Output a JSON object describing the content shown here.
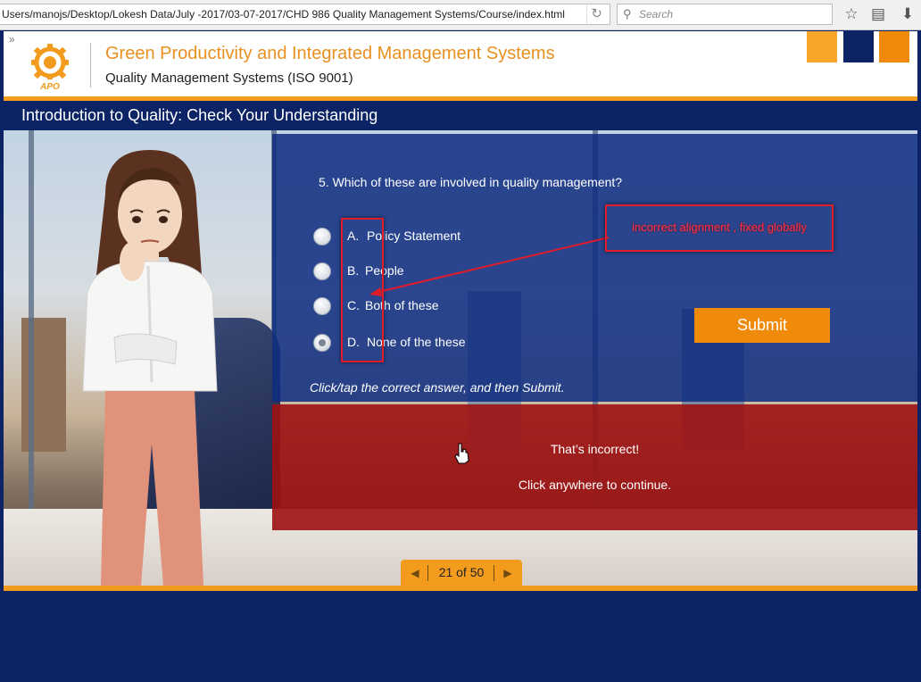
{
  "browser": {
    "url": "Users/manojs/Desktop/Lokesh Data/July -2017/03-07-2017/CHD 986 Quality Management Systems/Course/index.html",
    "search_placeholder": "Search",
    "icons": [
      "reload-icon",
      "search-icon",
      "bookmark-star-icon",
      "reading-list-icon",
      "download-icon"
    ]
  },
  "header": {
    "logo_text": "APO",
    "title": "Green Productivity and Integrated Management Systems",
    "subtitle": "Quality Management Systems (ISO 9001)",
    "squares": [
      "#f9a52a",
      "#0c2466",
      "#ef8a0a"
    ],
    "accent": "#f29b1d"
  },
  "slide": {
    "title": "Introduction to Quality: Check Your Understanding"
  },
  "quiz": {
    "question": "5. Which of these are involved in quality management?",
    "options": [
      {
        "letter": "A.",
        "text": "Policy Statement",
        "selected": false
      },
      {
        "letter": "B.",
        "text": "People",
        "selected": false
      },
      {
        "letter": "C.",
        "text": "Both of these",
        "selected": false
      },
      {
        "letter": "D.",
        "text": "None of the these",
        "selected": true
      }
    ],
    "submit_label": "Submit",
    "instruction": "Click/tap the correct answer, and then Submit."
  },
  "feedback": {
    "title": "That’s incorrect!",
    "text": "Click anywhere to continue."
  },
  "annotation": {
    "text": "incorrect alignment , fixed globally",
    "color": "#e01b2a"
  },
  "pager": {
    "text": "21 of 50",
    "prev_icon": "chevron-left-icon",
    "next_icon": "chevron-right-icon"
  }
}
